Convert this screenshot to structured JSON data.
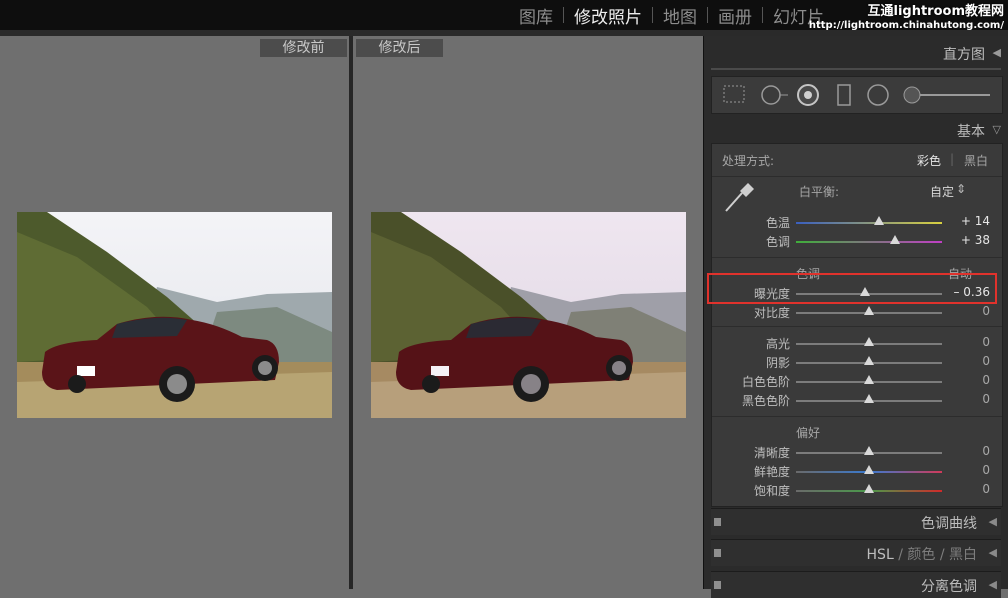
{
  "modules": {
    "library": "图库",
    "develop": "修改照片",
    "map": "地图",
    "book": "画册",
    "slideshow": "幻灯片"
  },
  "watermark": {
    "line1": "互通lightroom教程网",
    "line2": "http://lightroom.chinahutong.com/"
  },
  "compare": {
    "before_label": "修改前",
    "after_label": "修改后"
  },
  "histogram_panel": {
    "title": "直方图"
  },
  "basic_panel": {
    "title": "基本",
    "treatment_label": "处理方式:",
    "treatment_color": "彩色",
    "treatment_bw": "黑白",
    "wb_label": "白平衡:",
    "wb_value": "自定",
    "tone_group": "色调",
    "auto": "自动",
    "presence_group": "偏好",
    "sliders": [
      {
        "label": "色温",
        "value": "+ 14",
        "level": 0.57
      },
      {
        "label": "色调",
        "value": "+ 38",
        "level": 0.68
      },
      {
        "label": "曝光度",
        "value": "– 0.36",
        "level": 0.47
      },
      {
        "label": "对比度",
        "value": "0",
        "level": 0.5
      },
      {
        "label": "高光",
        "value": "0",
        "level": 0.5
      },
      {
        "label": "阴影",
        "value": "0",
        "level": 0.5
      },
      {
        "label": "白色色阶",
        "value": "0",
        "level": 0.5
      },
      {
        "label": "黑色色阶",
        "value": "0",
        "level": 0.5
      },
      {
        "label": "清晰度",
        "value": "0",
        "level": 0.5
      },
      {
        "label": "鲜艳度",
        "value": "0",
        "level": 0.5
      },
      {
        "label": "饱和度",
        "value": "0",
        "level": 0.5
      }
    ]
  },
  "tone_curve_panel": {
    "title": "色调曲线"
  },
  "hsl_panel": {
    "hsl": "HSL",
    "color": "颜色",
    "bw": "黑白",
    "slash": "/"
  },
  "split_panel": {
    "title": "分离色调"
  }
}
